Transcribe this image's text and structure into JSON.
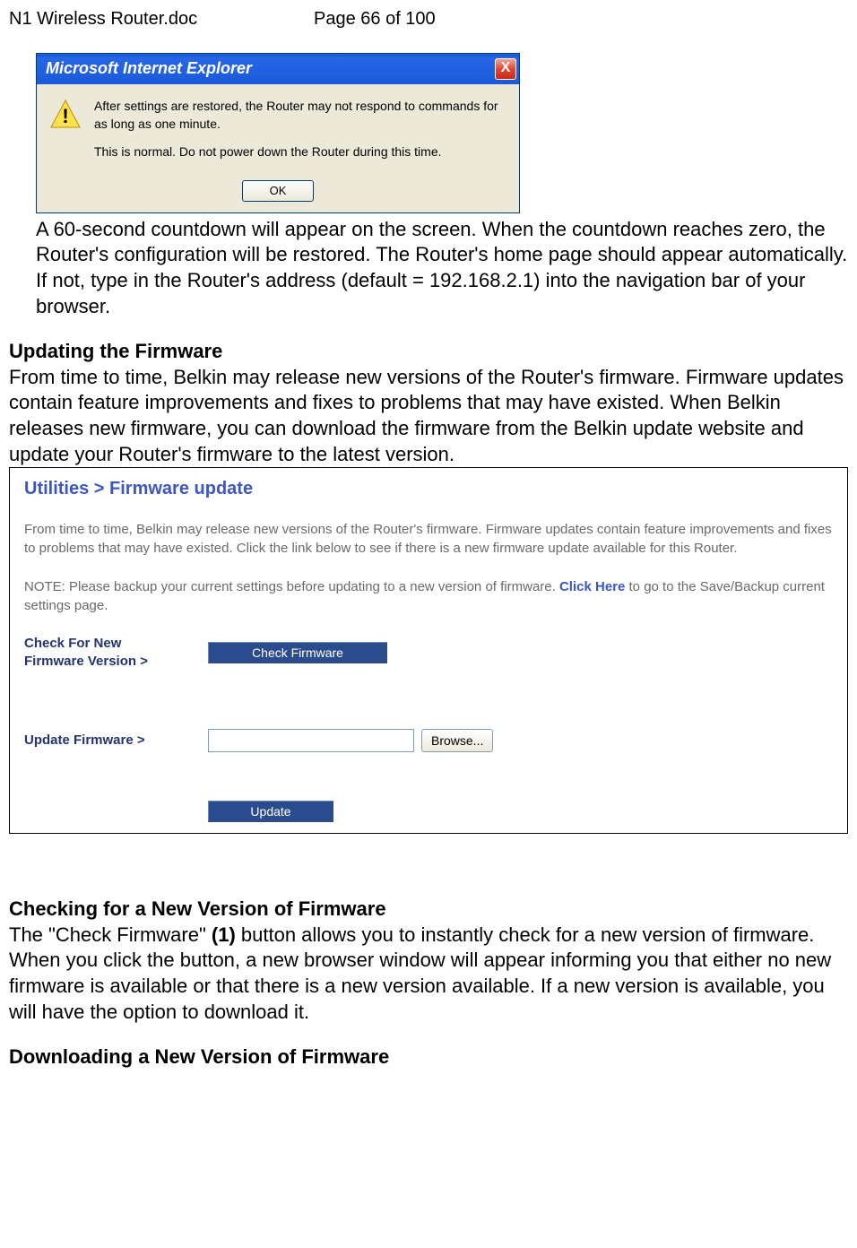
{
  "header": {
    "doc_name": "N1 Wireless Router.doc",
    "page_info": "Page 66 of 100"
  },
  "dialog": {
    "title": "Microsoft Internet Explorer",
    "line1": "After settings are restored, the Router may not respond to commands for as long as one minute.",
    "line2": "This is normal. Do not power down the Router during this time.",
    "ok": "OK",
    "close": "X"
  },
  "body": {
    "countdown_para": "A 60-second countdown will appear on the screen. When the countdown reaches zero, the Router's configuration will be restored. The Router's home page should appear automatically. If not, type in the Router's address (default = 192.168.2.1) into the navigation bar of your browser.",
    "updating_heading": "Updating the Firmware",
    "updating_para": "From time to time, Belkin may release new versions of the Router's firmware. Firmware updates contain feature improvements and fixes to problems that may have existed. When Belkin releases new firmware, you can download the firmware from the Belkin update website and update your Router's firmware to the latest version.",
    "checking_heading": "Checking for a New Version of Firmware",
    "checking_para_prefix": "The \"Check Firmware\" ",
    "checking_bold": "(1)",
    "checking_para_suffix": " button allows you to instantly check for a new version of firmware. When you click the button, a new browser window will appear informing you that either no new firmware is available or that there is a new version available. If a new version is available, you will have the option to download it.",
    "downloading_heading": "Downloading a New Version of Firmware"
  },
  "panel": {
    "title": "Utilities > Firmware update",
    "para1": "From time to time, Belkin may release new versions of the Router's firmware. Firmware updates contain feature improvements and fixes to problems that may have existed. Click the link below to see if there is a new firmware update available for this Router.",
    "note_prefix": "NOTE: Please backup your current settings before updating to a new version of firmware. ",
    "click_here": "Click Here",
    "note_suffix": " to go to the Save/Backup current settings page.",
    "check_label_l1": "Check For New",
    "check_label_l2": "Firmware Version >",
    "check_btn": "Check Firmware",
    "update_label": "Update Firmware >",
    "browse_btn": "Browse...",
    "update_btn": "Update"
  }
}
